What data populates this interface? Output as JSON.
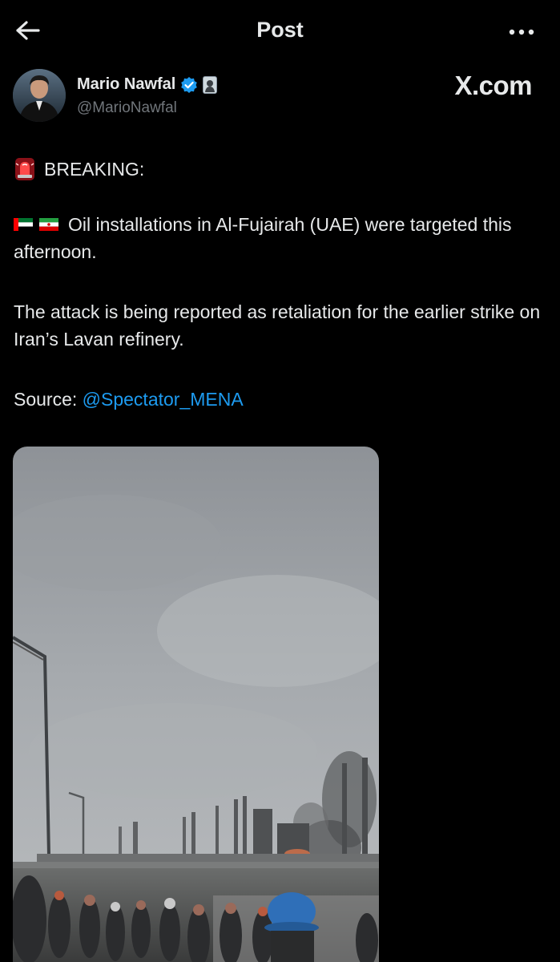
{
  "header": {
    "title": "Post"
  },
  "author": {
    "name": "Mario Nawfal",
    "handle": "@MarioNawfal",
    "verified_color": "#1d9bf0"
  },
  "brand": "X.com",
  "tweet": {
    "line1_icon": "rotating-light-icon",
    "line1_text": "BREAKING:",
    "flags": [
      "uae-flag-icon",
      "iran-flag-icon"
    ],
    "para2_text": "Oil installations in Al-Fujairah (UAE) were targeted this afternoon.",
    "para3_text": "The attack is being reported as retaliation for the earlier strike on Iran’s Lavan refinery.",
    "source_label": "Source: ",
    "source_mention": "@Spectator_MENA"
  },
  "colors": {
    "background": "#000000",
    "text": "#e7e9ea",
    "secondary": "#71767b",
    "link": "#1d9bf0"
  }
}
